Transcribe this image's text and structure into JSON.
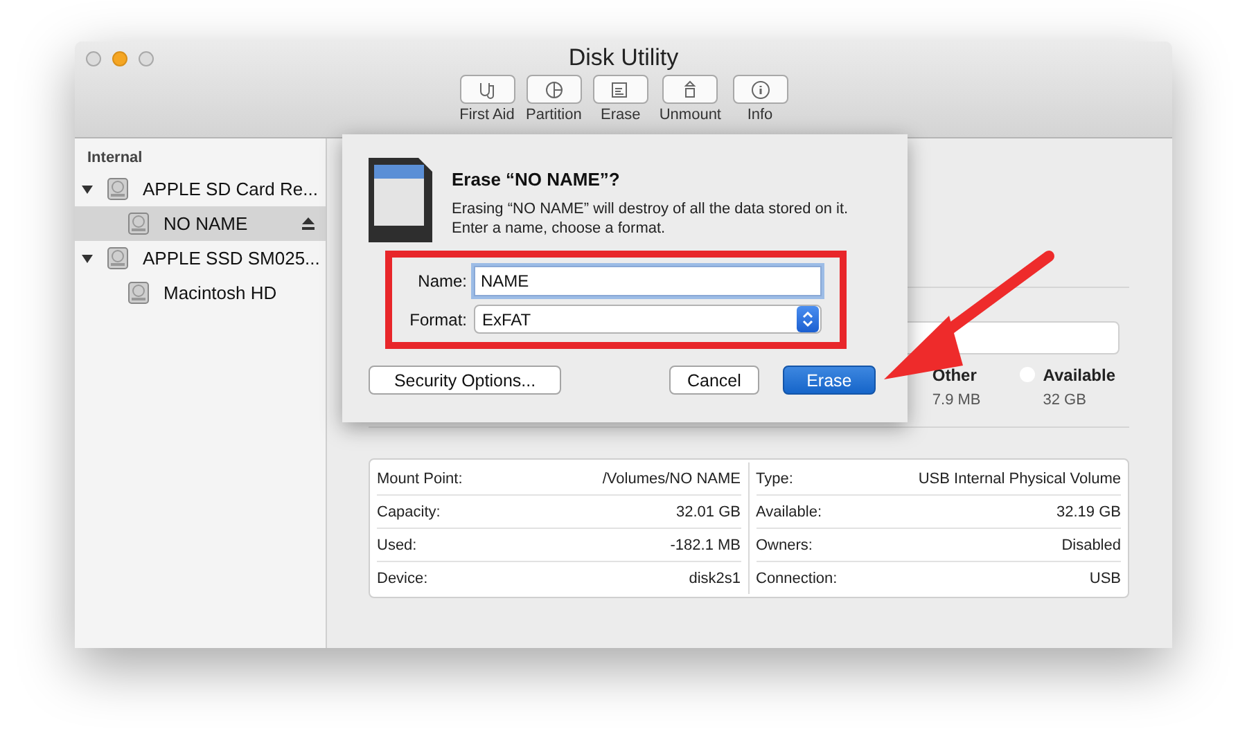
{
  "window": {
    "title": "Disk Utility"
  },
  "toolbar": [
    {
      "label": "First Aid",
      "kind": "firstaid"
    },
    {
      "label": "Partition",
      "kind": "partition"
    },
    {
      "label": "Erase",
      "kind": "erase"
    },
    {
      "label": "Unmount",
      "kind": "unmount"
    },
    {
      "label": "Info",
      "kind": "info"
    }
  ],
  "sidebar": {
    "heading": "Internal",
    "items": [
      {
        "label": "APPLE SD Card Re...",
        "expanded": true,
        "selected": false,
        "children": [
          {
            "label": "NO NAME",
            "selected": true,
            "ejectable": true
          }
        ]
      },
      {
        "label": "APPLE SSD SM025...",
        "expanded": true,
        "selected": false,
        "children": [
          {
            "label": "Macintosh HD",
            "selected": false,
            "ejectable": false
          }
        ]
      }
    ]
  },
  "usage_legend": [
    {
      "label": "Other",
      "value": "7.9 MB"
    },
    {
      "label": "Available",
      "value": "32 GB",
      "color": "#ffffff"
    }
  ],
  "info_table": {
    "left": [
      {
        "label": "Mount Point:",
        "value": "/Volumes/NO NAME"
      },
      {
        "label": "Capacity:",
        "value": "32.01 GB"
      },
      {
        "label": "Used:",
        "value": "-182.1 MB"
      },
      {
        "label": "Device:",
        "value": "disk2s1"
      }
    ],
    "right": [
      {
        "label": "Type:",
        "value": "USB Internal Physical Volume"
      },
      {
        "label": "Available:",
        "value": "32.19 GB"
      },
      {
        "label": "Owners:",
        "value": "Disabled"
      },
      {
        "label": "Connection:",
        "value": "USB"
      }
    ]
  },
  "dialog": {
    "title": "Erase “NO NAME”?",
    "message": "Erasing “NO NAME” will destroy of all the data stored on it. Enter a name, choose a format.",
    "name_label": "Name:",
    "name_value": "NAME",
    "format_label": "Format:",
    "format_value": "ExFAT",
    "buttons": [
      {
        "label": "Security Options...",
        "kind": "plain"
      },
      {
        "label": "Cancel",
        "kind": "plain"
      },
      {
        "label": "Erase",
        "kind": "default"
      }
    ]
  }
}
